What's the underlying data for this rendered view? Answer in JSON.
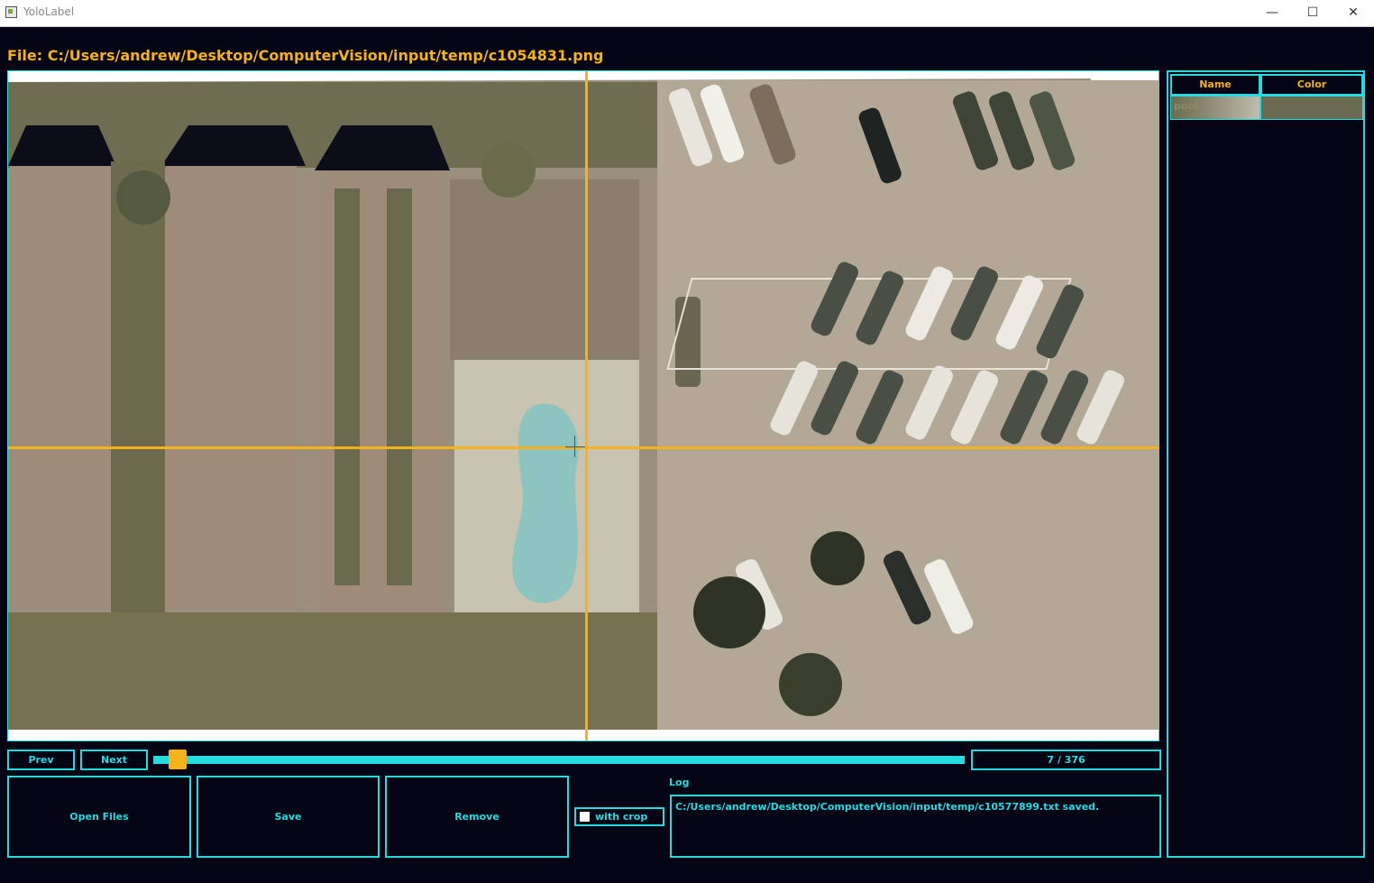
{
  "window": {
    "title": "YoloLabel",
    "minimize_glyph": "—",
    "maximize_glyph": "☐",
    "close_glyph": "✕"
  },
  "file_label": "File: C:/Users/andrew/Desktop/ComputerVision/input/temp/c1054831.png",
  "nav": {
    "prev_label": "Prev",
    "next_label": "Next",
    "progress_text": "7 / 376",
    "current_index": 7,
    "total": 376
  },
  "actions": {
    "open_files_label": "Open Files",
    "save_label": "Save",
    "remove_label": "Remove",
    "with_crop_label": "with crop",
    "with_crop_checked": false
  },
  "log": {
    "label": "Log",
    "text": "C:/Users/andrew/Desktop/ComputerVision/input/temp/c10577899.txt saved."
  },
  "class_table": {
    "headers": [
      "Name",
      "Color"
    ],
    "rows": [
      {
        "name": "pool",
        "color": "#6b6b52"
      }
    ]
  },
  "colors": {
    "accent": "#25dbe0",
    "crosshair": "#f5b21d",
    "background": "#040414",
    "header_text": "#f5b21d"
  }
}
